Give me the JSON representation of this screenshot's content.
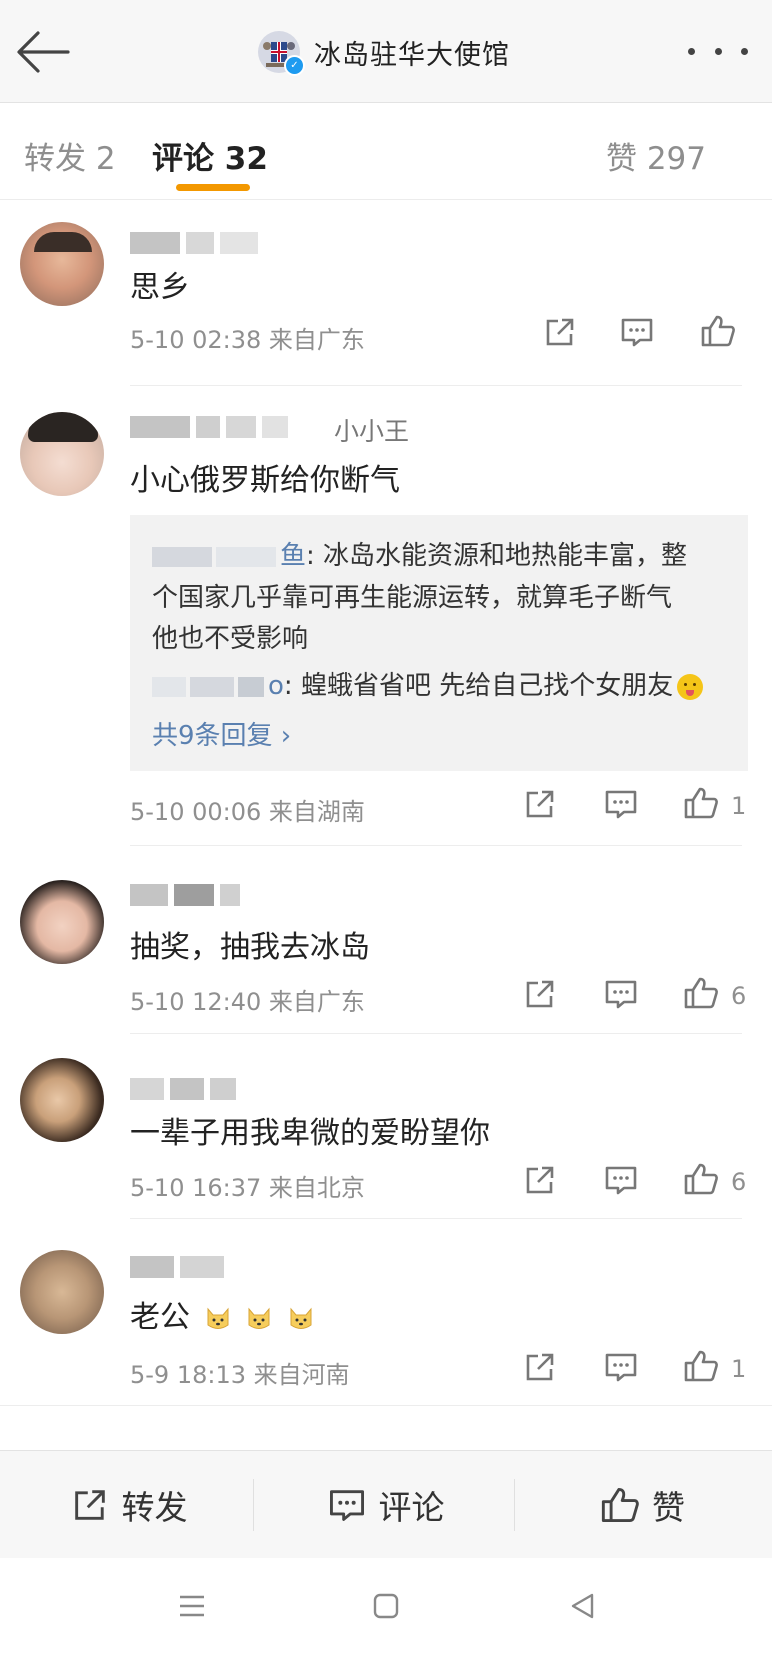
{
  "header": {
    "title": "冰岛驻华大使馆"
  },
  "tabs": {
    "repost": "转发 2",
    "comments": "评论 32",
    "likes": "赞 297"
  },
  "comments": [
    {
      "user_suffix": "",
      "text": "思乡",
      "meta": "5-10 02:38  来自广东",
      "likes": ""
    },
    {
      "user_suffix": "小小王",
      "text": "小心俄罗斯给你断气",
      "meta": "5-10 00:06  来自湖南",
      "likes": "1",
      "replies": [
        {
          "name_tail": "鱼",
          "text_line1": ": 冰岛水能资源和地热能丰富，整",
          "text_line2": "个国家几乎靠可再生能源运转，就算毛子断气",
          "text_line3": "他也不受影响"
        },
        {
          "name_tail": "o",
          "text": ": 蝗蛾省省吧 先给自己找个女朋友"
        }
      ],
      "more_replies": "共9条回复 ›"
    },
    {
      "user_suffix": "",
      "text": "抽奖，抽我去冰岛",
      "meta": "5-10 12:40  来自广东",
      "likes": "6"
    },
    {
      "user_suffix": "",
      "text": "一辈子用我卑微的爱盼望你",
      "meta": "5-10 16:37  来自北京",
      "likes": "6"
    },
    {
      "user_suffix": "",
      "text": "老公",
      "meta": "5-9 18:13  来自河南",
      "likes": "1"
    }
  ],
  "bottom_bar": {
    "repost": "转发",
    "comment": "评论",
    "like": "赞"
  },
  "colors": {
    "accent": "#f39800",
    "link": "#5a80b0",
    "verified": "#1e9bf0"
  }
}
